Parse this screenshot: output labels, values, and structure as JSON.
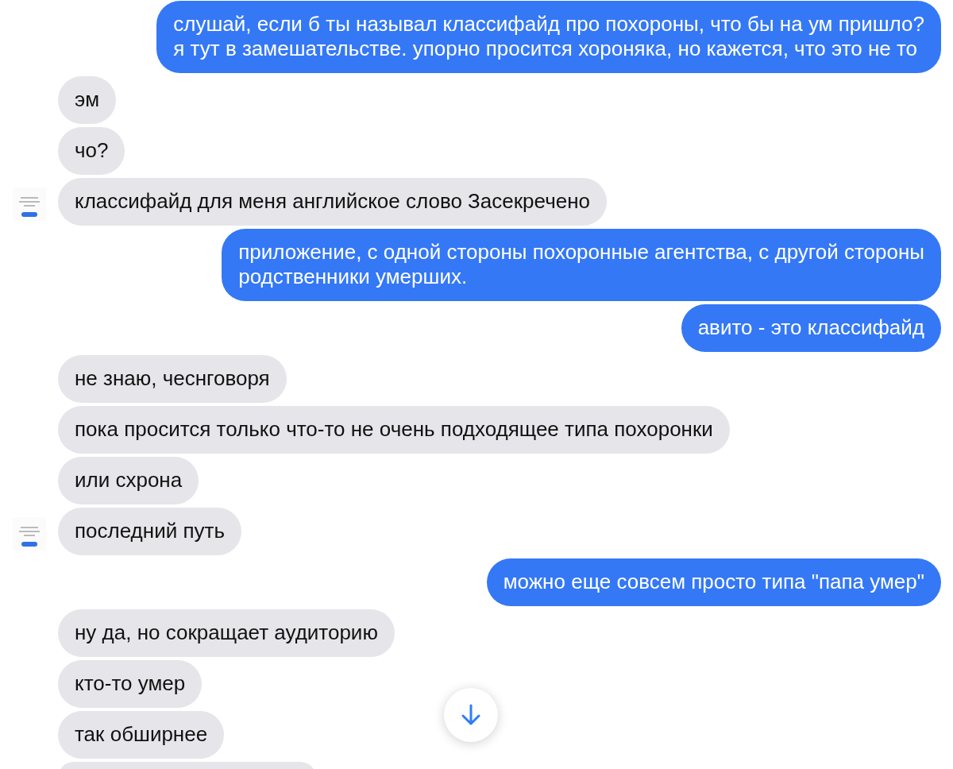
{
  "messages": [
    {
      "kind": "outgoing",
      "avatar": false,
      "text": "слушай, если б ты называл классифайд про похороны, что бы на ум  пришло?\nя тут в замешательстве. упорно просится хороняка, но кажется, что это не то"
    },
    {
      "kind": "incoming",
      "avatar": false,
      "text": "эм"
    },
    {
      "kind": "incoming",
      "avatar": false,
      "text": "чо?"
    },
    {
      "kind": "incoming",
      "avatar": true,
      "text": "классифайд для меня английское слово Засекречено"
    },
    {
      "kind": "outgoing",
      "avatar": false,
      "text": "приложение, с одной стороны похоронные агентства, с другой стороны\nродственники умерших."
    },
    {
      "kind": "outgoing",
      "avatar": false,
      "text": "авито - это классифайд"
    },
    {
      "kind": "incoming",
      "avatar": false,
      "text": "не знаю, чеснговоря"
    },
    {
      "kind": "incoming",
      "avatar": false,
      "text": "пока просится только что-то не очень подходящее типа похоронки"
    },
    {
      "kind": "incoming",
      "avatar": false,
      "text": "или схрона"
    },
    {
      "kind": "incoming",
      "avatar": true,
      "text": "последний путь"
    },
    {
      "kind": "outgoing",
      "avatar": false,
      "text": "можно еще совсем просто типа \"папа умер\""
    },
    {
      "kind": "incoming",
      "avatar": false,
      "text": "ну да, но сокращает аудиторию"
    },
    {
      "kind": "incoming",
      "avatar": false,
      "text": "кто-то умер"
    },
    {
      "kind": "incoming",
      "avatar": false,
      "text": "так обширнее"
    }
  ]
}
